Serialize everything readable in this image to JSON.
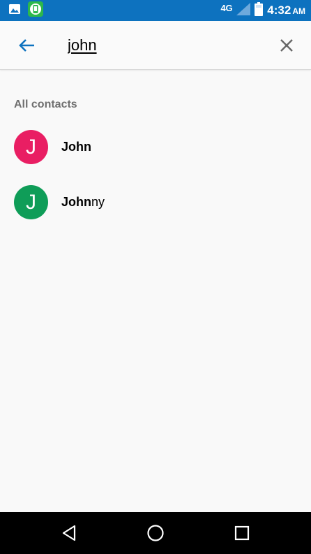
{
  "status_bar": {
    "network": "4G",
    "time": "4:32",
    "ampm": "AM",
    "background": "#0d72bf"
  },
  "toolbar": {
    "search_value": "john"
  },
  "section": {
    "title": "All contacts"
  },
  "contacts": [
    {
      "initial": "J",
      "match": "John",
      "rest": "",
      "avatar_color": "#e91e63"
    },
    {
      "initial": "J",
      "match": "John",
      "rest": "ny",
      "avatar_color": "#0f9d58"
    }
  ],
  "icons": {
    "back": "arrow-back-icon",
    "clear": "close-icon",
    "nav_back": "nav-back-icon",
    "nav_home": "nav-home-icon",
    "nav_recents": "nav-recents-icon"
  }
}
